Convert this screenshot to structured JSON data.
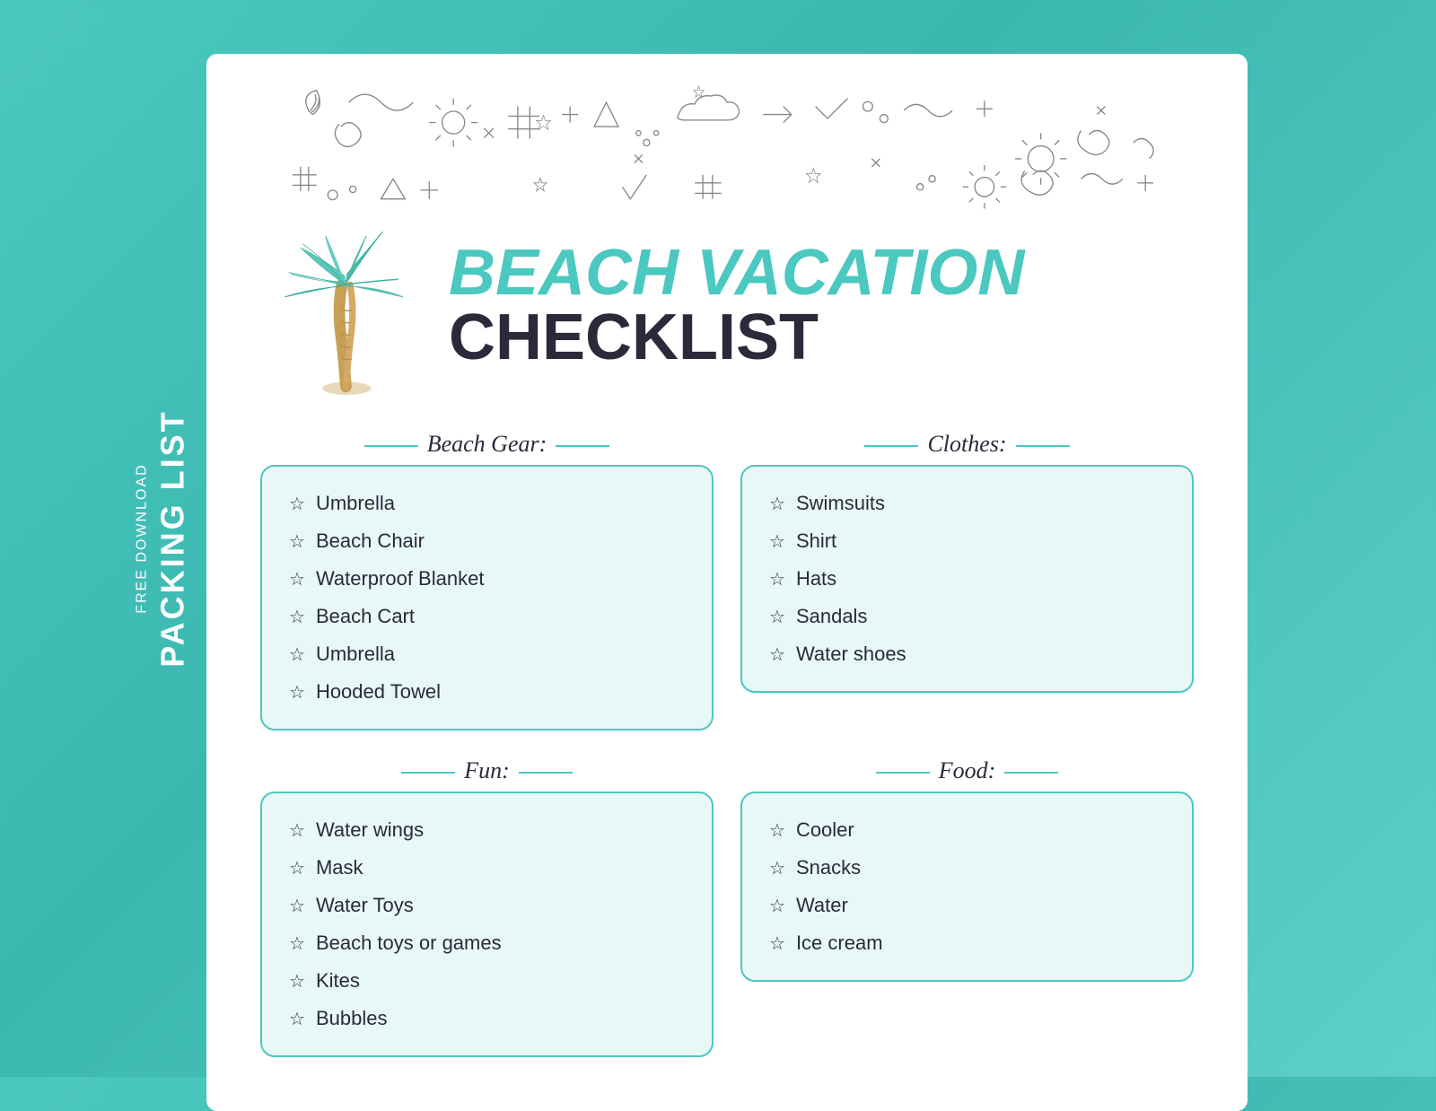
{
  "sidebar": {
    "free_download": "FREE DOWNLOAD",
    "packing_list": "PACKING LIST"
  },
  "header": {
    "title_line1": "BEACH VACATION",
    "title_line2": "CHECKLIST"
  },
  "categories": [
    {
      "id": "beach-gear",
      "title": "Beach Gear:",
      "items": [
        "Umbrella",
        "Beach Chair",
        "Waterproof Blanket",
        "Beach Cart",
        "Umbrella",
        "Hooded Towel"
      ]
    },
    {
      "id": "clothes",
      "title": "Clothes:",
      "items": [
        "Swimsuits",
        "Shirt",
        "Hats",
        "Sandals",
        "Water shoes"
      ]
    },
    {
      "id": "fun",
      "title": "Fun:",
      "items": [
        "Water wings",
        "Mask",
        "Water Toys",
        "Beach toys or games",
        "Kites",
        "Bubbles"
      ]
    },
    {
      "id": "food",
      "title": "Food:",
      "items": [
        "Cooler",
        "Snacks",
        "Water",
        "Ice cream"
      ]
    }
  ]
}
